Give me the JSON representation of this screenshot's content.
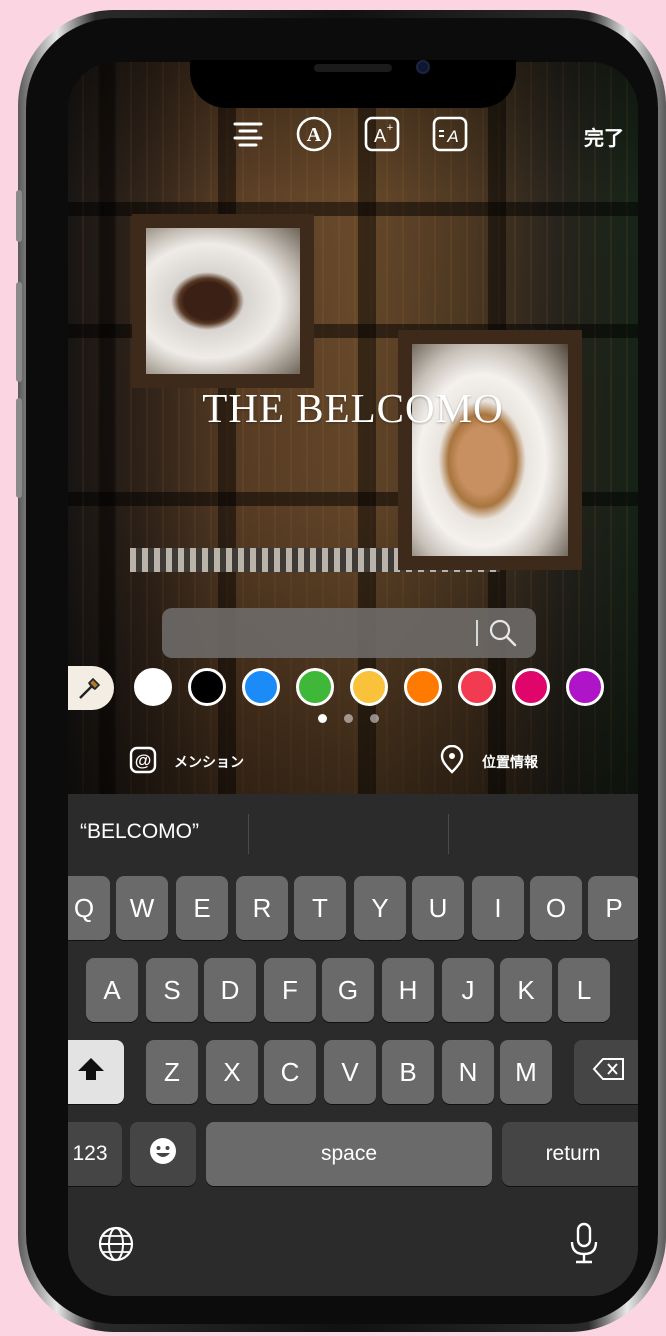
{
  "toolbar": {
    "done_label": "完了",
    "icons": [
      "align-center-icon",
      "text-style-icon",
      "text-effect-icon",
      "text-background-icon"
    ]
  },
  "story": {
    "title_text": "THE BELCOMO"
  },
  "search": {
    "value": "",
    "placeholder": ""
  },
  "colors": {
    "swatches": [
      "#ffffff",
      "#000000",
      "#1b8cf7",
      "#3fb83a",
      "#f9c23a",
      "#ff7a00",
      "#f23b50",
      "#e0056b",
      "#b014c8"
    ],
    "page_count": 3,
    "active_page": 0
  },
  "actions": {
    "mention_label": "メンション",
    "location_label": "位置情報"
  },
  "keyboard": {
    "suggestions": [
      "“BELCOMO”",
      "",
      ""
    ],
    "row1": [
      "Q",
      "W",
      "E",
      "R",
      "T",
      "Y",
      "U",
      "I",
      "O",
      "P"
    ],
    "row2": [
      "A",
      "S",
      "D",
      "F",
      "G",
      "H",
      "J",
      "K",
      "L"
    ],
    "row3": [
      "Z",
      "X",
      "C",
      "V",
      "B",
      "N",
      "M"
    ],
    "numbers_label": "123",
    "space_label": "space",
    "return_label": "return"
  }
}
